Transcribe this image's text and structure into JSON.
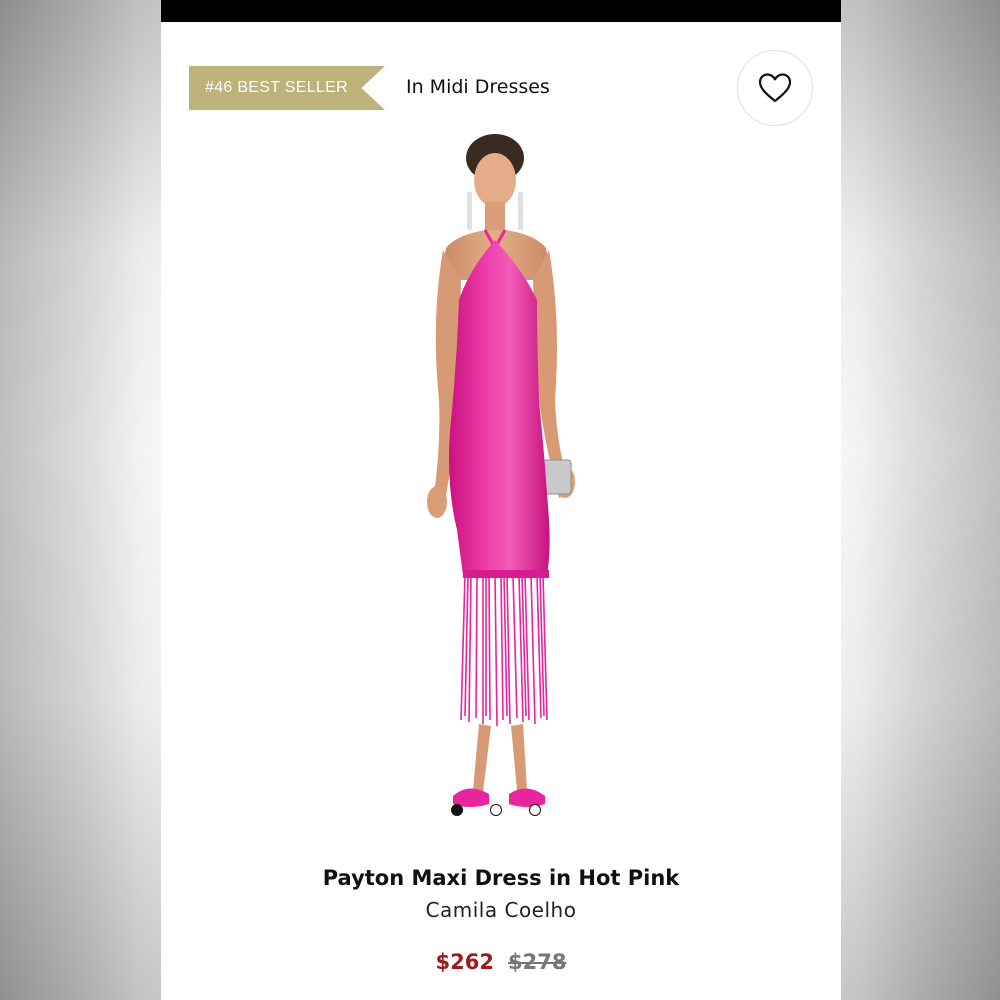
{
  "badge": {
    "rank_label": "#46 BEST SELLER",
    "category_label": "In Midi Dresses",
    "color": "#bcb27a"
  },
  "favorite": {
    "icon": "heart-icon"
  },
  "product": {
    "name": "Payton Maxi Dress in Hot Pink",
    "brand": "Camila Coelho",
    "sale_price": "$262",
    "original_price": "$278",
    "dress_color": "#e8249e",
    "sale_color": "#9b1c1c"
  },
  "carousel": {
    "total": 3,
    "active_index": 0
  }
}
